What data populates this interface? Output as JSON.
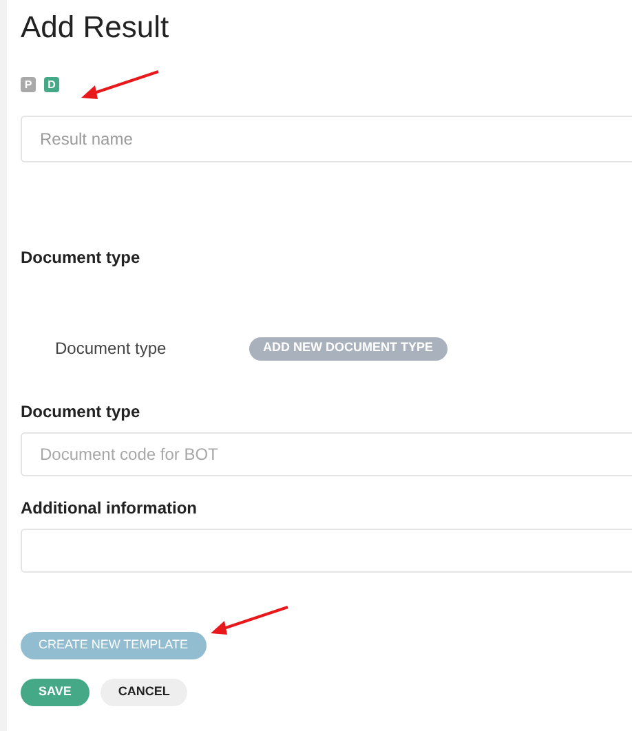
{
  "title": "Add Result",
  "badges": [
    {
      "label": "P",
      "selected": false
    },
    {
      "label": "D",
      "selected": true
    }
  ],
  "result_name": {
    "placeholder": "Result name"
  },
  "document_type_heading": "Document type",
  "document_type_row": {
    "label": "Document type",
    "button": "ADD NEW DOCUMENT TYPE"
  },
  "document_code": {
    "label": "Document type",
    "placeholder": "Document code for BOT"
  },
  "additional_information": {
    "label": "Additional information"
  },
  "create_template_button": "CREATE NEW TEMPLATE",
  "buttons": [
    {
      "label": "SAVE",
      "kind": "primary"
    },
    {
      "label": "CANCEL",
      "kind": "secondary"
    }
  ]
}
